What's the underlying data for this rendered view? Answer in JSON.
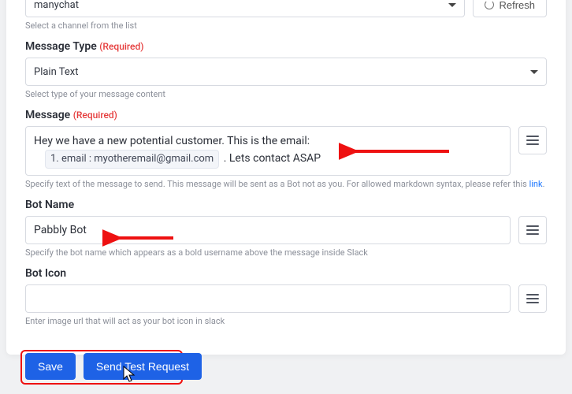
{
  "channel": {
    "selected": "manychat",
    "helper": "Select a channel from the list",
    "refresh_label": "Refresh"
  },
  "message_type": {
    "label": "Message Type",
    "required_tag": "(Required)",
    "selected": "Plain Text",
    "helper": "Select type of your message content"
  },
  "message": {
    "label": "Message",
    "required_tag": "(Required)",
    "text_before": "Hey we have a new potential customer. This is the email:",
    "chip_label": "1. email : myotheremail@gmail.com",
    "text_after": ". Lets contact ASAP",
    "helper_prefix": "Specify text of the message to send. This message will be sent as a Bot not as you. For allowed markdown syntax, please refer this ",
    "helper_link_text": "link",
    "helper_suffix": "."
  },
  "bot_name": {
    "label": "Bot Name",
    "value": "Pabbly Bot",
    "helper": "Specify the bot name which appears as a bold username above the message inside Slack"
  },
  "bot_icon": {
    "label": "Bot Icon",
    "value": "",
    "helper": "Enter image url that will act as your bot icon in slack"
  },
  "buttons": {
    "save": "Save",
    "send_test": "Send Test Request"
  }
}
